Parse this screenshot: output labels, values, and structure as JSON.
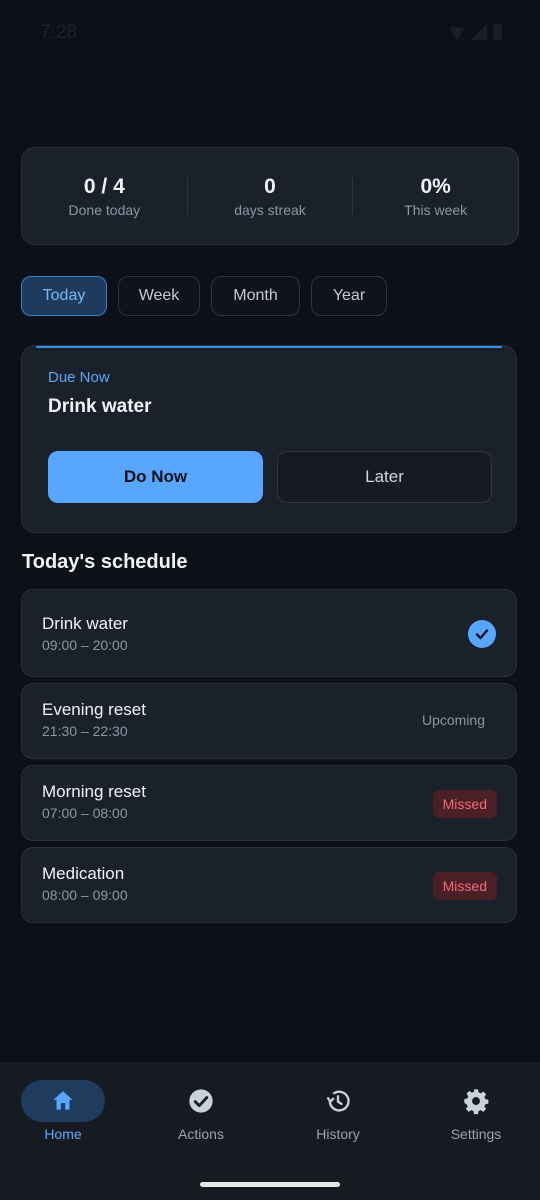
{
  "statusbar": {
    "time": "7:28"
  },
  "stats": [
    {
      "value": "0 / 4",
      "label": "Done today"
    },
    {
      "value": "0",
      "label": "days streak"
    },
    {
      "value": "0%",
      "label": "This week"
    }
  ],
  "filters": [
    "Today",
    "Week",
    "Month",
    "Year"
  ],
  "due": {
    "eyebrow": "Due Now",
    "title": "Drink water",
    "primary_label": "Do Now",
    "secondary_label": "Later"
  },
  "schedule": {
    "title": "Today's schedule",
    "items": [
      {
        "name": "Drink water",
        "time": "09:00 – 20:00",
        "status": "done"
      },
      {
        "name": "Evening reset",
        "time": "21:30 – 22:30",
        "status": "Upcoming"
      },
      {
        "name": "Morning reset",
        "time": "07:00 – 08:00",
        "status": "Missed"
      },
      {
        "name": "Medication",
        "time": "08:00 – 09:00",
        "status": "Missed"
      }
    ]
  },
  "nav": [
    {
      "label": "Home",
      "icon": "home-icon"
    },
    {
      "label": "Actions",
      "icon": "check-circle-icon"
    },
    {
      "label": "History",
      "icon": "history-icon"
    },
    {
      "label": "Settings",
      "icon": "gear-icon"
    }
  ],
  "colors": {
    "accent": "#58a6ff",
    "missed": "#f26b7a",
    "background": "#0d1117",
    "card": "#1b212b"
  }
}
